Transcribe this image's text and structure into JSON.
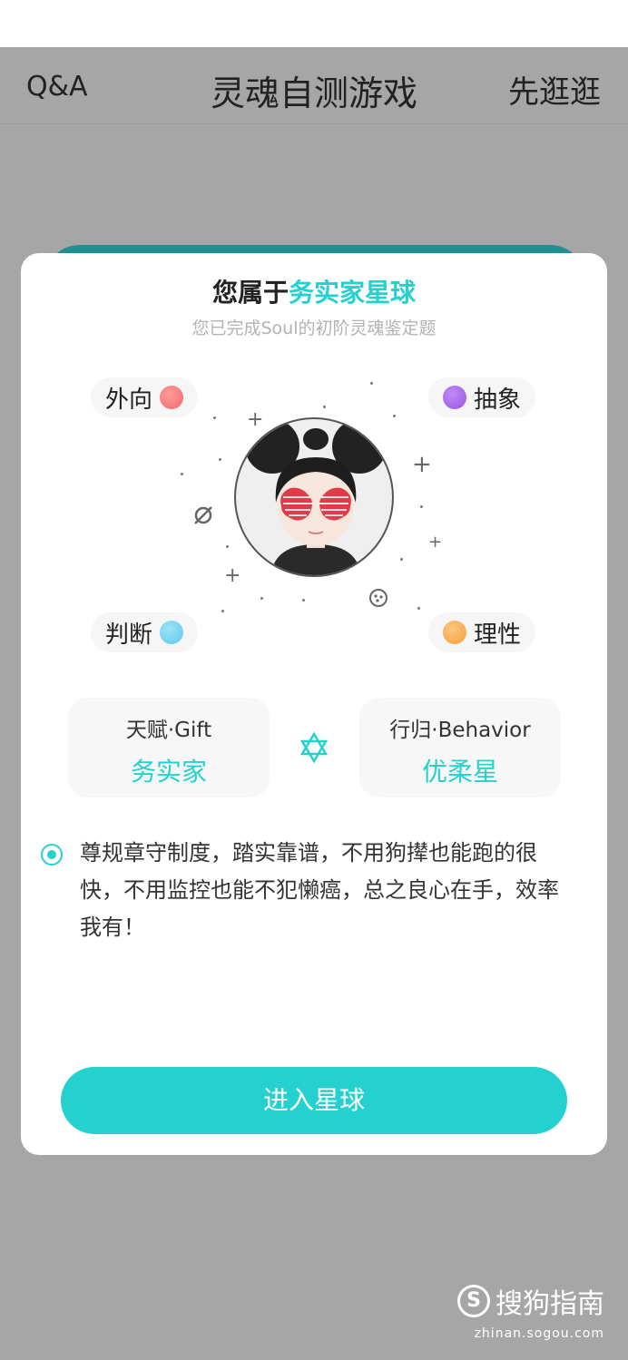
{
  "header": {
    "left": "Q&A",
    "title": "灵魂自测游戏",
    "right": "先逛逛"
  },
  "card": {
    "title_prefix": "您属于",
    "title_highlight": "务实家星球",
    "subtitle": "您已完成Soul的初阶灵魂鉴定题",
    "traits": [
      {
        "label": "外向",
        "color": "#f06b6b"
      },
      {
        "label": "抽象",
        "color": "#9a54e6"
      },
      {
        "label": "判断",
        "color": "#5cc9ee"
      },
      {
        "label": "理性",
        "color": "#f5a13b"
      }
    ],
    "gift": {
      "label": "天赋·Gift",
      "value": "务实家"
    },
    "behavior": {
      "label": "行归·Behavior",
      "value": "优柔星"
    },
    "description": "尊规章守制度，踏实靠谱，不用狗撵也能跑的很快，不用监控也能不犯懒癌，总之良心在手，效率我有！",
    "button": "进入星球"
  },
  "watermark": {
    "brand": "搜狗指南",
    "url": "zhinan.sogou.com"
  },
  "colors": {
    "accent": "#25d1cf",
    "overlay": "#a6a6a6"
  }
}
